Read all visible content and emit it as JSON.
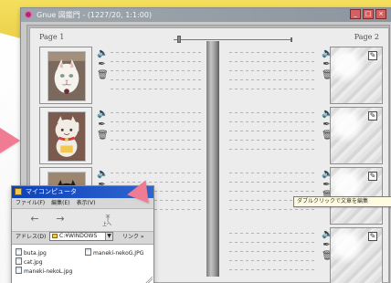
{
  "window": {
    "title": "Gnue 図鑑門 - (1227/20, 1:1:00)",
    "buttons": [
      "_",
      "□",
      "×"
    ]
  },
  "book": {
    "left_page_label": "Page 1",
    "right_page_label": "Page 2",
    "tooltip": "ダブルクリックで文章を編集"
  },
  "icons": {
    "speaker": "speaker-icon",
    "pen": "pen-icon",
    "trash": "trash-icon",
    "edit": "edit-icon"
  },
  "explorer": {
    "title": "マイコンピュータ",
    "menu": [
      "ファイル(F)",
      "編集(E)",
      "表示(V)"
    ],
    "toolbar": {
      "back": "←",
      "forward": "→",
      "up": "上へ"
    },
    "address_label": "アドレス(D)",
    "address_value": "C:¥WINDOWS",
    "links_label": "リンク »",
    "files": [
      {
        "name": "buta.jpg"
      },
      {
        "name": "maneki-nekoG.JPG"
      },
      {
        "name": "cat.jpg"
      },
      {
        "name": "maneki-nekoL.jpg"
      }
    ]
  }
}
